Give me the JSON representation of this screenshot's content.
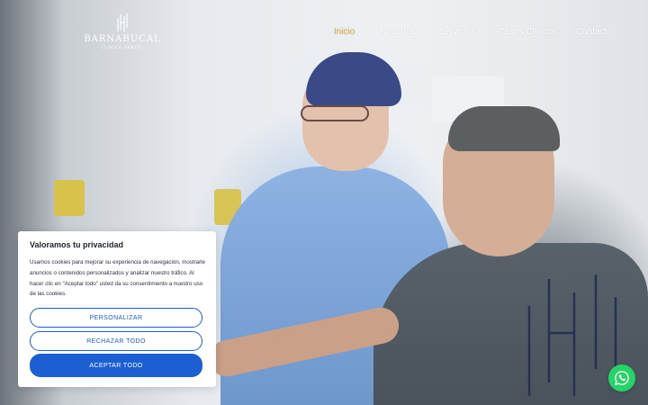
{
  "brand": {
    "name": "BARNABUCAL",
    "subtitle": "CLÍNICA DENTAL"
  },
  "nav": {
    "items": [
      {
        "label": "Inicio",
        "active": true
      },
      {
        "label": "Nosotros",
        "active": false
      },
      {
        "label": "Servicios",
        "active": false
      },
      {
        "label": "Casos Clínicos",
        "active": false
      },
      {
        "label": "Contacto",
        "active": false
      }
    ]
  },
  "cookie": {
    "title": "Valoramos tu privacidad",
    "text": "Usamos cookies para mejorar su experiencia de navegación, mostrarle anuncios o contenidos personalizados y analizar nuestro tráfico. Al hacer clic en \"Aceptar todo\" usted da su consentimiento a nuestro uso de las cookies.",
    "customize_label": "PERSONALIZAR",
    "reject_label": "RECHAZAR TODO",
    "accept_label": "ACEPTAR TODO"
  },
  "colors": {
    "accent": "#e3b24a",
    "primary_button": "#1b5fd3",
    "whatsapp": "#25d366"
  },
  "icons": {
    "whatsapp": "whatsapp-icon",
    "logo": "logo-mark-icon"
  }
}
